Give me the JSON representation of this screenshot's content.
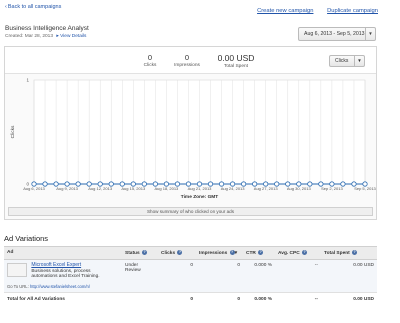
{
  "nav": {
    "back": "Back to all campaigns"
  },
  "header": {
    "create": "Create new campaign",
    "duplicate": "Duplicate campaign"
  },
  "campaign": {
    "name": "Business Intelligence Analyst",
    "created": "Created: Mar 28, 2013",
    "view_details": "View Details"
  },
  "date_range": "Aug 6, 2013 - Sep 5, 2013",
  "stats": {
    "clicks_value": "0",
    "clicks_label": "Clicks",
    "impressions_value": "0",
    "impressions_label": "Impressions",
    "spent_value": "0.00 USD",
    "spent_label": "Total Spent"
  },
  "metric_select": "Clicks",
  "chart_data": {
    "type": "line",
    "ylabel": "Clicks",
    "xlabel": "Time Zone: GMT",
    "x": [
      "Aug 6, 2013",
      "Aug 7, 2013",
      "Aug 8, 2013",
      "Aug 9, 2013",
      "Aug 10, 2013",
      "Aug 11, 2013",
      "Aug 12, 2013",
      "Aug 13, 2013",
      "Aug 14, 2013",
      "Aug 15, 2013",
      "Aug 16, 2013",
      "Aug 17, 2013",
      "Aug 18, 2013",
      "Aug 19, 2013",
      "Aug 20, 2013",
      "Aug 21, 2013",
      "Aug 22, 2013",
      "Aug 23, 2013",
      "Aug 24, 2013",
      "Aug 25, 2013",
      "Aug 26, 2013",
      "Aug 27, 2013",
      "Aug 28, 2013",
      "Aug 29, 2013",
      "Aug 30, 2013",
      "Aug 31, 2013",
      "Sep 1, 2013",
      "Sep 2, 2013",
      "Sep 3, 2013",
      "Sep 4, 2013",
      "Sep 5, 2013"
    ],
    "tick_labels": [
      "Aug 6, 2013",
      "Aug 9, 2013",
      "Aug 12, 2013",
      "Aug 15, 2013",
      "Aug 18, 2013",
      "Aug 21, 2013",
      "Aug 24, 2013",
      "Aug 27, 2013",
      "Aug 30, 2013",
      "Sep 2, 2013",
      "Sep 5, 2013"
    ],
    "series": [
      {
        "values": [
          0,
          0,
          0,
          0,
          0,
          0,
          0,
          0,
          0,
          0,
          0,
          0,
          0,
          0,
          0,
          0,
          0,
          0,
          0,
          0,
          0,
          0,
          0,
          0,
          0,
          0,
          0,
          0,
          0,
          0,
          0
        ]
      }
    ],
    "y_ticks": [
      "1",
      "0"
    ],
    "ylim": [
      0,
      1
    ],
    "grid": true,
    "colors": {
      "line": "#2a6ab0",
      "marker_fill": "#ffffff",
      "grid": "#e0e0e0"
    }
  },
  "show_summary": "Show summary of who clicked on your ads",
  "ad_variations": {
    "title": "Ad Variations",
    "columns": [
      "Ad",
      "Status",
      "Clicks",
      "Impressions",
      "CTR",
      "Avg. CPC",
      "Total Spent"
    ],
    "sort_marker": "▾",
    "rows": [
      {
        "title": "Microsoft Excel Expert",
        "description": "Business solutions, process automations and Excel Training.",
        "goto_label": "Go To URL:",
        "goto_url": "http://www.stefanielsheet.com/n/",
        "status": "Under Review",
        "clicks": "0",
        "impressions": "0",
        "ctr": "0.000 %",
        "avg_cpc": "--",
        "total_spent": "0.00 USD"
      }
    ],
    "total": {
      "label": "Total for All Ad Variations",
      "clicks": "0",
      "impressions": "0",
      "ctr": "0.000 %",
      "avg_cpc": "--",
      "total_spent": "0.00 USD"
    }
  },
  "colors": {
    "link": "#2255aa",
    "header_bg": "#ececec"
  }
}
